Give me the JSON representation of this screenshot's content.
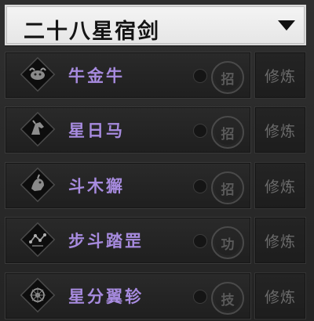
{
  "header": {
    "title": "二十八星宿剑",
    "dropdown_icon": "triangle-down-icon"
  },
  "skills": [
    {
      "name": "牛金牛",
      "type": "招",
      "action": "修炼",
      "icon": "bull-emblem-icon"
    },
    {
      "name": "星日马",
      "type": "招",
      "action": "修炼",
      "icon": "horse-emblem-icon"
    },
    {
      "name": "斗木獬",
      "type": "招",
      "action": "修炼",
      "icon": "beast-emblem-icon"
    },
    {
      "name": "步斗踏罡",
      "type": "功",
      "action": "修炼",
      "icon": "constellation-emblem-icon"
    },
    {
      "name": "星分翼轸",
      "type": "技",
      "action": "修炼",
      "icon": "star-wheel-emblem-icon"
    }
  ],
  "colors": {
    "skill_name": "#a78bdf",
    "header_bg": "#f0f0f0",
    "panel_bg": "#242424"
  }
}
